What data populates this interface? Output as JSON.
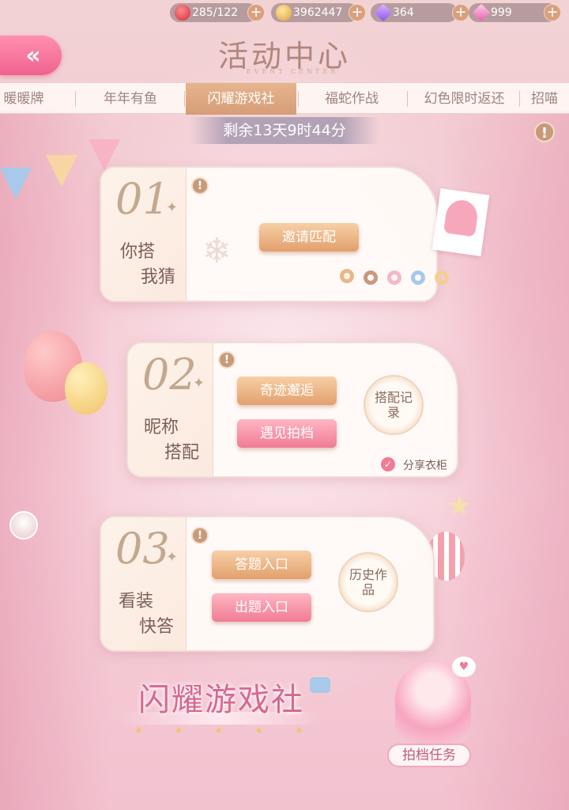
{
  "resources": [
    {
      "icon": "heart-icon",
      "value": "285/122"
    },
    {
      "icon": "cat-coin-icon",
      "value": "3962447"
    },
    {
      "icon": "purple-diamond-icon",
      "value": "364"
    },
    {
      "icon": "pink-diamond-icon",
      "value": "999"
    }
  ],
  "header": {
    "title": "活动中心",
    "subtitle": "EVENT CENTER",
    "back_glyph": "«"
  },
  "tabs": [
    {
      "label": "暖暖牌",
      "active": false
    },
    {
      "label": "年年有鱼",
      "active": false
    },
    {
      "label": "闪耀游戏社",
      "active": true
    },
    {
      "label": "福蛇作战",
      "active": false
    },
    {
      "label": "幻色限时返还",
      "active": false
    },
    {
      "label": "招喵",
      "active": false
    }
  ],
  "countdown": "剩余13天9时44分",
  "cards": [
    {
      "number": "01",
      "label_line1": "你搭",
      "label_line2": "我猜",
      "buttons": [
        "邀请匹配"
      ]
    },
    {
      "number": "02",
      "label_line1": "昵称",
      "label_line2": "搭配",
      "buttons": [
        "奇迹邂逅",
        "遇见拍档"
      ],
      "round_button": "搭配记录",
      "share_label": "分享衣柜"
    },
    {
      "number": "03",
      "label_line1": "看装",
      "label_line2": "快答",
      "buttons": [
        "答题入口",
        "出题入口"
      ],
      "round_button": "历史作品"
    }
  ],
  "brand_text": "闪耀游戏社",
  "task_badge": "拍档任务",
  "colors": {
    "accent_gold": "#e2a06d",
    "accent_pink": "#f07b94",
    "title": "#b2867c"
  }
}
